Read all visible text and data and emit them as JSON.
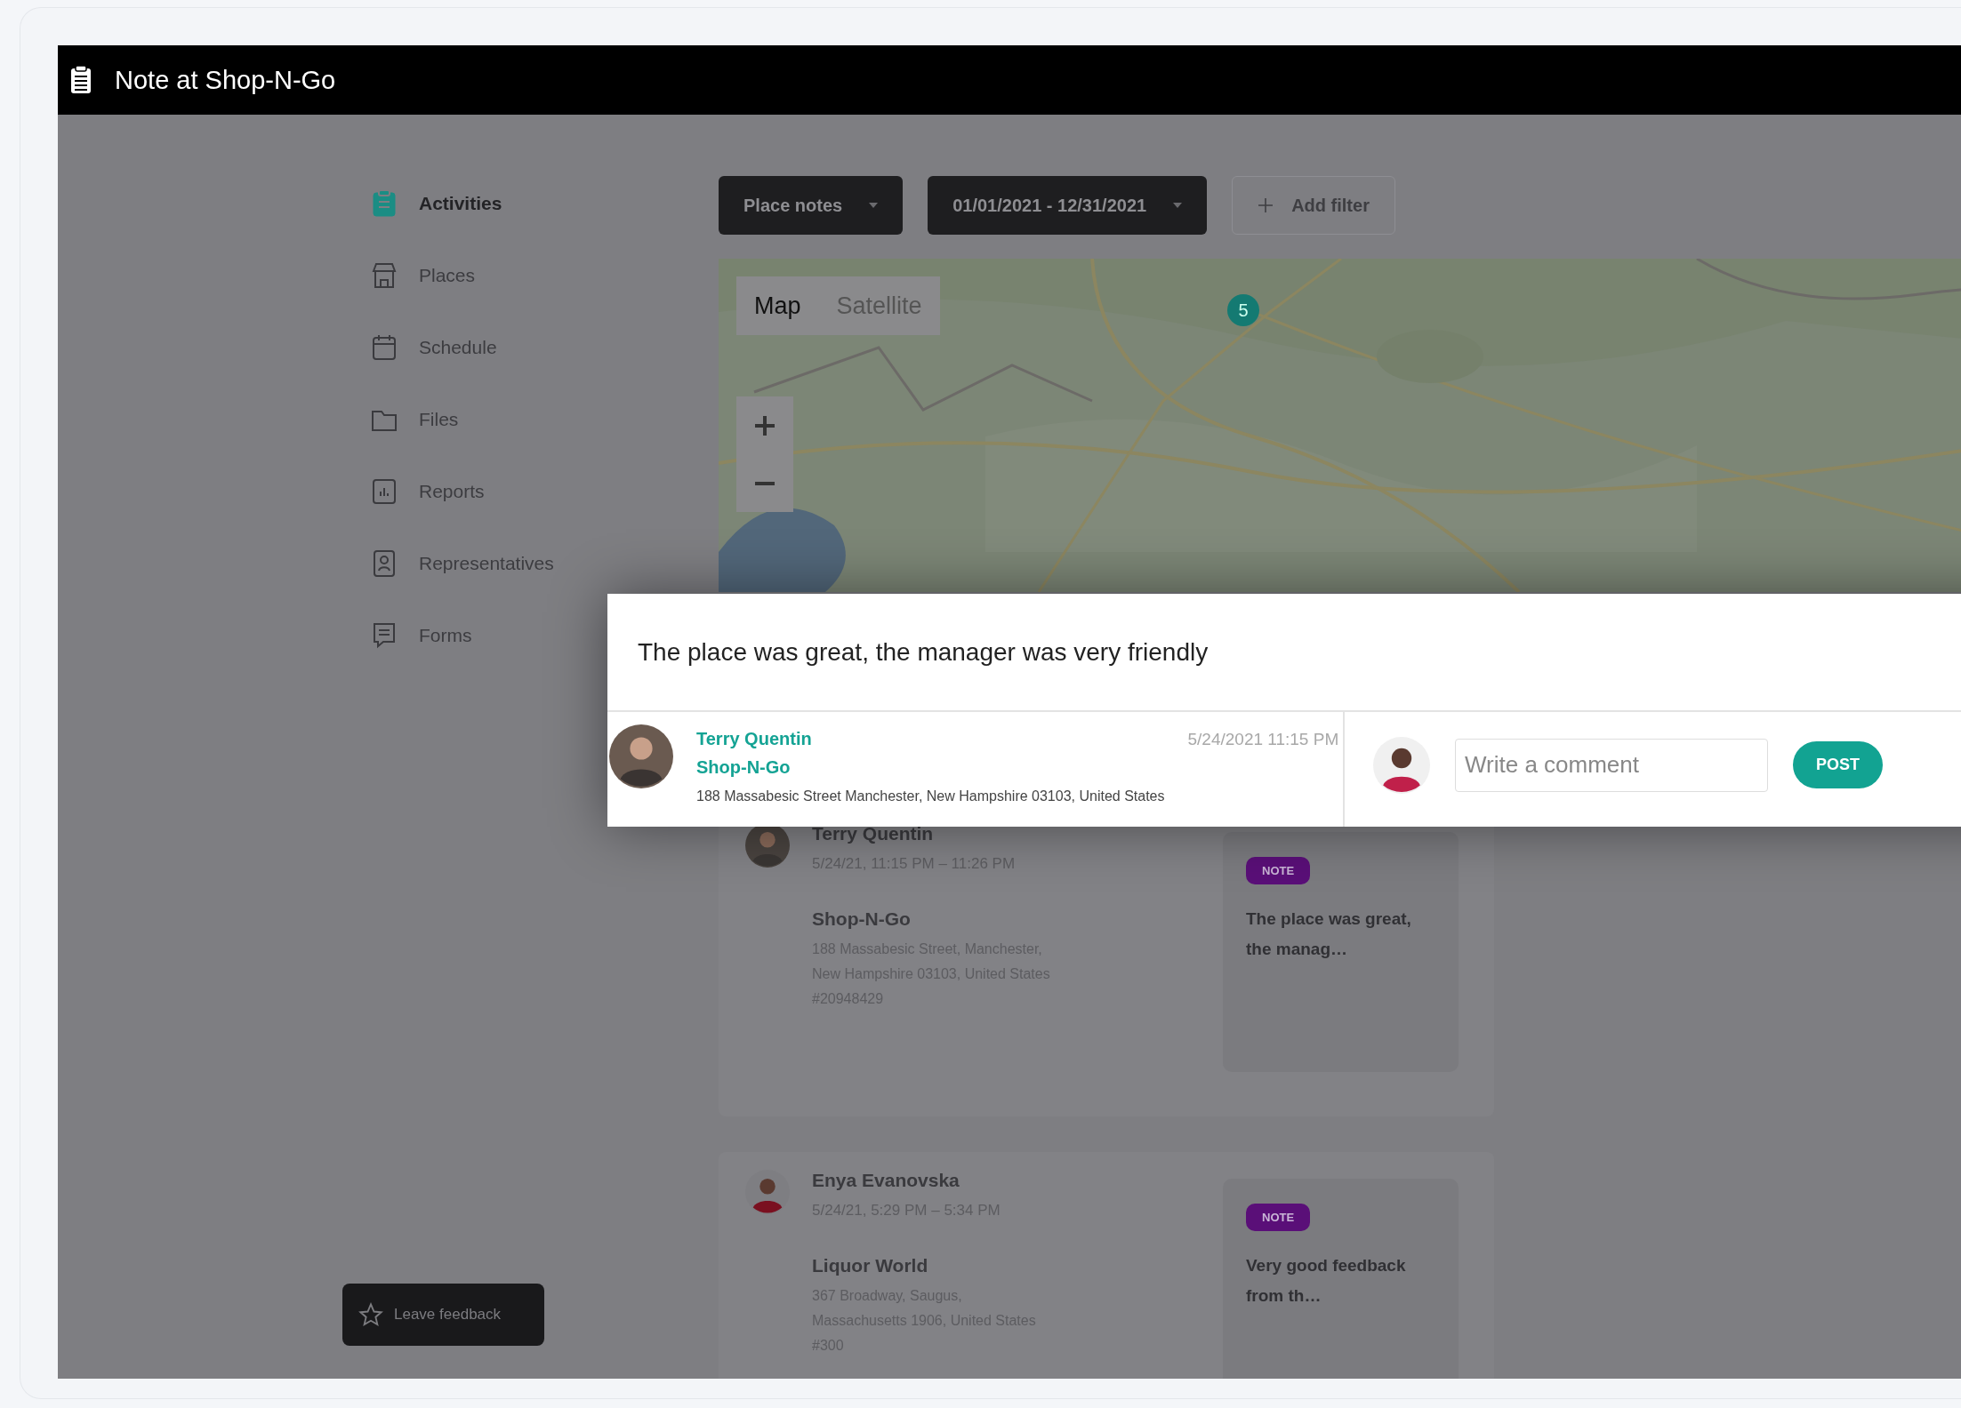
{
  "window": {
    "title": "Note at Shop-N-Go"
  },
  "sidebar": {
    "items": [
      {
        "label": "Activities",
        "selected": true
      },
      {
        "label": "Places",
        "selected": false
      },
      {
        "label": "Schedule",
        "selected": false
      },
      {
        "label": "Files",
        "selected": false
      },
      {
        "label": "Reports",
        "selected": false
      },
      {
        "label": "Representatives",
        "selected": false
      },
      {
        "label": "Forms",
        "selected": false
      }
    ],
    "feedback_button": "Leave feedback"
  },
  "filters": [
    {
      "label": "Place notes",
      "kind": "dropdown"
    },
    {
      "label": "01/01/2021 - 12/31/2021",
      "kind": "dropdown"
    },
    {
      "label": "Add filter",
      "kind": "add"
    }
  ],
  "map": {
    "kind": "picture",
    "types": [
      {
        "label": "Map",
        "selected": true
      },
      {
        "label": "Satellite",
        "selected": false
      }
    ],
    "cluster": "5"
  },
  "activities": [
    {
      "name": "Terry Quentin",
      "time": "5/24/21, 11:15 PM – 11:26 PM",
      "place": "Shop-N-Go",
      "address": [
        "188 Massabesic Street, Manchester,",
        "New Hampshire 03103, United States"
      ],
      "ref": "#20948429",
      "tag": "NOTE",
      "note": "The place was great, the manag…"
    },
    {
      "name": "Enya Evanovska",
      "time": "5/24/21, 5:29 PM – 5:34 PM",
      "place": "Liquor World",
      "address": [
        "367 Broadway, Saugus,",
        "Massachusetts 1906, United States"
      ],
      "ref": "#300",
      "tag": "NOTE",
      "note": "Very good feedback from th…"
    }
  ],
  "note_dialog": {
    "text": "The place was great, the manager was very friendly",
    "author": "Terry Quentin",
    "place": "Shop-N-Go",
    "date": "5/24/2021 11:15 PM",
    "address": "188 Massabesic Street Manchester, New Hampshire 03103, United States",
    "comment": {
      "placeholder": "Write a comment",
      "button": "POST"
    }
  }
}
